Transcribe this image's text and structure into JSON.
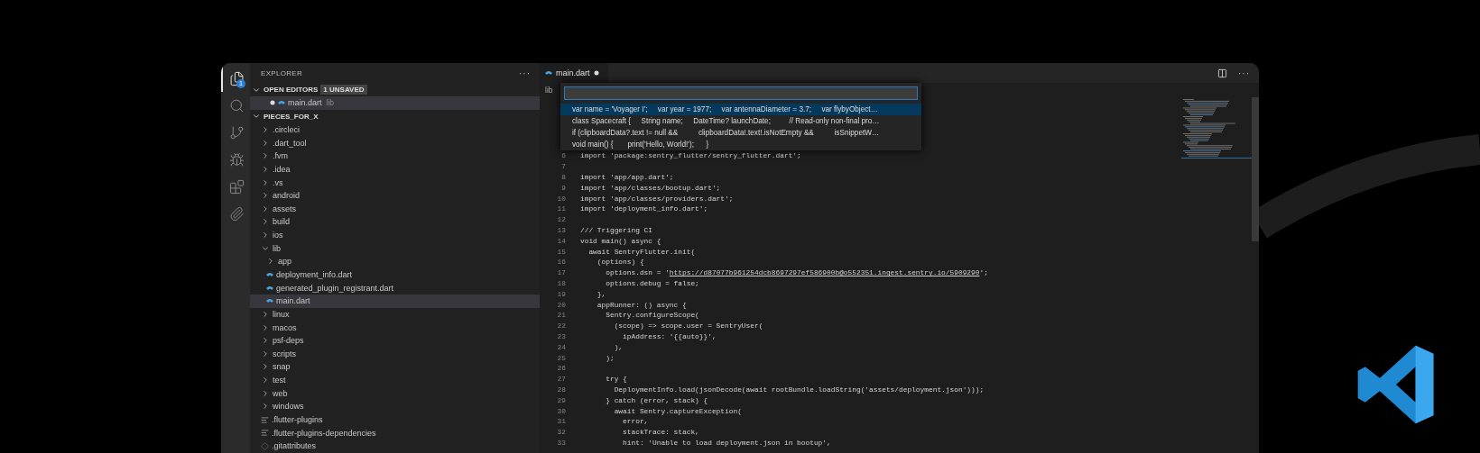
{
  "activity_bar": {
    "items": [
      {
        "kind": "files",
        "selected": true,
        "badge": "1"
      },
      {
        "kind": "search",
        "selected": false
      },
      {
        "kind": "source",
        "selected": false
      },
      {
        "kind": "debug",
        "selected": false
      },
      {
        "kind": "extensions",
        "selected": false
      },
      {
        "kind": "clip",
        "selected": false
      }
    ]
  },
  "sidebar": {
    "title": "EXPLORER",
    "more": "···",
    "open_editors": {
      "title": "OPEN EDITORS",
      "badge": "1 UNSAVED",
      "expanded": true,
      "items": [
        {
          "label": "main.dart",
          "path": "lib",
          "unsaved": true,
          "selected": true
        }
      ]
    },
    "folder": {
      "title": "PIECES_FOR_X",
      "expanded": true,
      "items": [
        {
          "kind": "folder",
          "label": ".circleci",
          "expanded": false,
          "selected": false
        },
        {
          "kind": "folder",
          "label": ".dart_tool",
          "expanded": false,
          "selected": false
        },
        {
          "kind": "folder",
          "label": ".fvm",
          "expanded": false,
          "selected": false
        },
        {
          "kind": "folder",
          "label": ".idea",
          "expanded": false,
          "selected": false
        },
        {
          "kind": "folder",
          "label": ".vs",
          "expanded": false,
          "selected": false
        },
        {
          "kind": "folder",
          "label": "android",
          "expanded": false,
          "selected": false
        },
        {
          "kind": "folder",
          "label": "assets",
          "expanded": false,
          "selected": false
        },
        {
          "kind": "folder",
          "label": "build",
          "expanded": false,
          "selected": false
        },
        {
          "kind": "folder",
          "label": "ios",
          "expanded": false,
          "selected": false
        },
        {
          "kind": "folder",
          "label": "lib",
          "expanded": true,
          "selected": false,
          "children": [
            {
              "kind": "folder",
              "label": "app",
              "expanded": false,
              "selected": false
            },
            {
              "kind": "dart",
              "label": "deployment_info.dart",
              "selected": false
            },
            {
              "kind": "dart",
              "label": "generated_plugin_registrant.dart",
              "selected": false
            },
            {
              "kind": "dart",
              "label": "main.dart",
              "selected": true
            }
          ]
        },
        {
          "kind": "folder",
          "label": "linux",
          "expanded": false,
          "selected": false
        },
        {
          "kind": "folder",
          "label": "macos",
          "expanded": false,
          "selected": false
        },
        {
          "kind": "folder",
          "label": "psf-deps",
          "expanded": false,
          "selected": false
        },
        {
          "kind": "folder",
          "label": "scripts",
          "expanded": false,
          "selected": false
        },
        {
          "kind": "folder",
          "label": "snap",
          "expanded": false,
          "selected": false
        },
        {
          "kind": "folder",
          "label": "test",
          "expanded": false,
          "selected": false
        },
        {
          "kind": "folder",
          "label": "web",
          "expanded": false,
          "selected": false
        },
        {
          "kind": "folder",
          "label": "windows",
          "expanded": false,
          "selected": false
        },
        {
          "kind": "text",
          "label": ".flutter-plugins",
          "selected": false
        },
        {
          "kind": "text",
          "label": ".flutter-plugins-dependencies",
          "selected": false
        },
        {
          "kind": "git",
          "label": ".gitattributes",
          "selected": false
        }
      ]
    }
  },
  "editor": {
    "tabs": [
      {
        "label": "main.dart",
        "selected": true,
        "unsaved": true
      }
    ],
    "breadcrumb": "lib",
    "quick_pick": {
      "input_focused": true,
      "items": [
        {
          "label": "var name = 'Voyager I';     var year = 1977;     var antennaDiameter = 3.7;     var flybyObject…",
          "selected": true
        },
        {
          "label": "class Spacecraft {     String name;     DateTime? launchDate;         // Read-only non-final pro…",
          "selected": false
        },
        {
          "label": "if (clipboardData?.text != null &&          clipboardData!.text!.isNotEmpty &&          isSnippetW…",
          "selected": false
        },
        {
          "label": "void main() {       print('Hello, World!');      }",
          "selected": false
        }
      ]
    },
    "lines": [
      {
        "n": "6",
        "code": "import 'package:sentry_flutter/sentry_flutter.dart';"
      },
      {
        "n": "7"
      },
      {
        "n": "8",
        "code": "import 'app/app.dart';"
      },
      {
        "n": "9",
        "code": "import 'app/classes/bootup.dart';"
      },
      {
        "n": "10",
        "code": "import 'app/classes/providers.dart';"
      },
      {
        "n": "11",
        "code": "import 'deployment_info.dart';"
      },
      {
        "n": "12"
      },
      {
        "n": "13",
        "code": "/// Triggering CI"
      },
      {
        "n": "14",
        "code": "void main() async {"
      },
      {
        "n": "15",
        "code": "  await SentryFlutter.init("
      },
      {
        "n": "16",
        "code": "    (options) {"
      },
      {
        "n": "17",
        "code": "      options.dsn = '",
        "link": "https://d87077b961254dcb8697297ef586900b@o552351.ingest.sentry.io/5909290",
        "tail": "';"
      },
      {
        "n": "18",
        "code": "      options.debug = false;"
      },
      {
        "n": "19",
        "code": "    },"
      },
      {
        "n": "20",
        "code": "    appRunner: () async {"
      },
      {
        "n": "21",
        "code": "      Sentry.configureScope("
      },
      {
        "n": "22",
        "code": "        (scope) => scope.user = SentryUser("
      },
      {
        "n": "23",
        "code": "          ipAddress: '{{auto}}',"
      },
      {
        "n": "24",
        "code": "        ),"
      },
      {
        "n": "25",
        "code": "      );"
      },
      {
        "n": "26"
      },
      {
        "n": "27",
        "code": "      try {"
      },
      {
        "n": "28",
        "code": "        DeploymentInfo.load(jsonDecode(await rootBundle.loadString('assets/deployment.json')));"
      },
      {
        "n": "29",
        "code": "      } catch (error, stack) {"
      },
      {
        "n": "30",
        "code": "        await Sentry.captureException("
      },
      {
        "n": "31",
        "code": "          error,"
      },
      {
        "n": "32",
        "code": "          stackTrace: stack,"
      },
      {
        "n": "33",
        "code": "          hint: 'Unable to load deployment.json in bootup',"
      }
    ]
  }
}
